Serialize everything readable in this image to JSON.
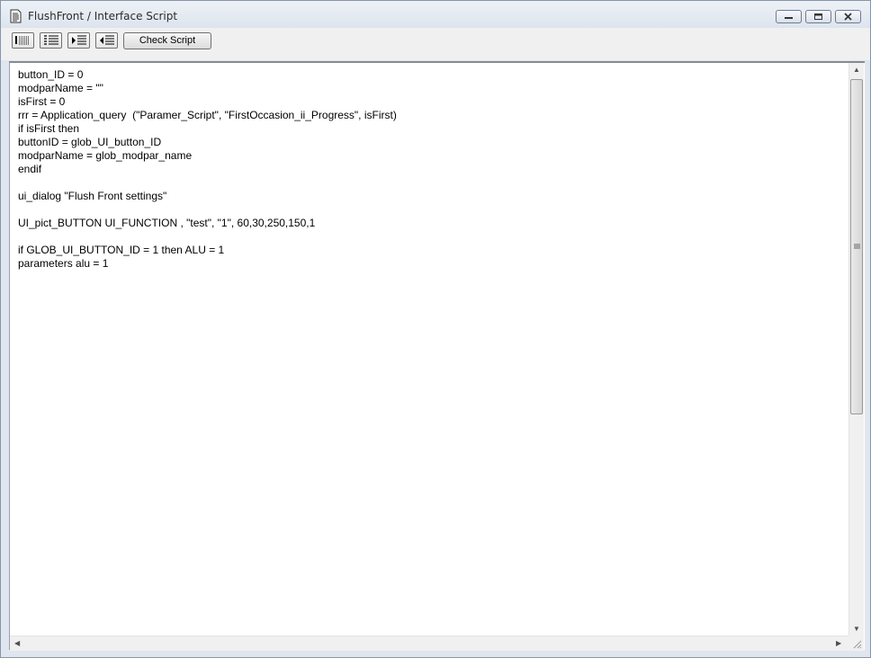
{
  "window": {
    "title": "FlushFront / Interface Script",
    "minimize_icon": "minimize-icon",
    "maximize_icon": "maximize-icon",
    "close_icon": "close-icon"
  },
  "toolbar": {
    "icons": [
      "comment-lines-icon",
      "numbered-list-icon",
      "indent-icon",
      "outdent-icon"
    ],
    "check_script_label": "Check Script"
  },
  "editor": {
    "script": "button_ID = 0\nmodparName = \"\"\nisFirst = 0\nrrr = Application_query  (\"Paramer_Script\", \"FirstOccasion_ii_Progress\", isFirst)\nif isFirst then\nbuttonID = glob_UI_button_ID\nmodparName = glob_modpar_name\nendif\n\nui_dialog \"Flush Front settings\"\n\nUI_pict_BUTTON UI_FUNCTION , \"test\", \"1\", 60,30,250,150,1\n\nif GLOB_UI_BUTTON_ID = 1 then ALU = 1\nparameters alu = 1"
  },
  "colors": {
    "titlebar": "#dde4ee",
    "toolbar": "#f0f0f0",
    "editor_bg": "#ffffff"
  }
}
